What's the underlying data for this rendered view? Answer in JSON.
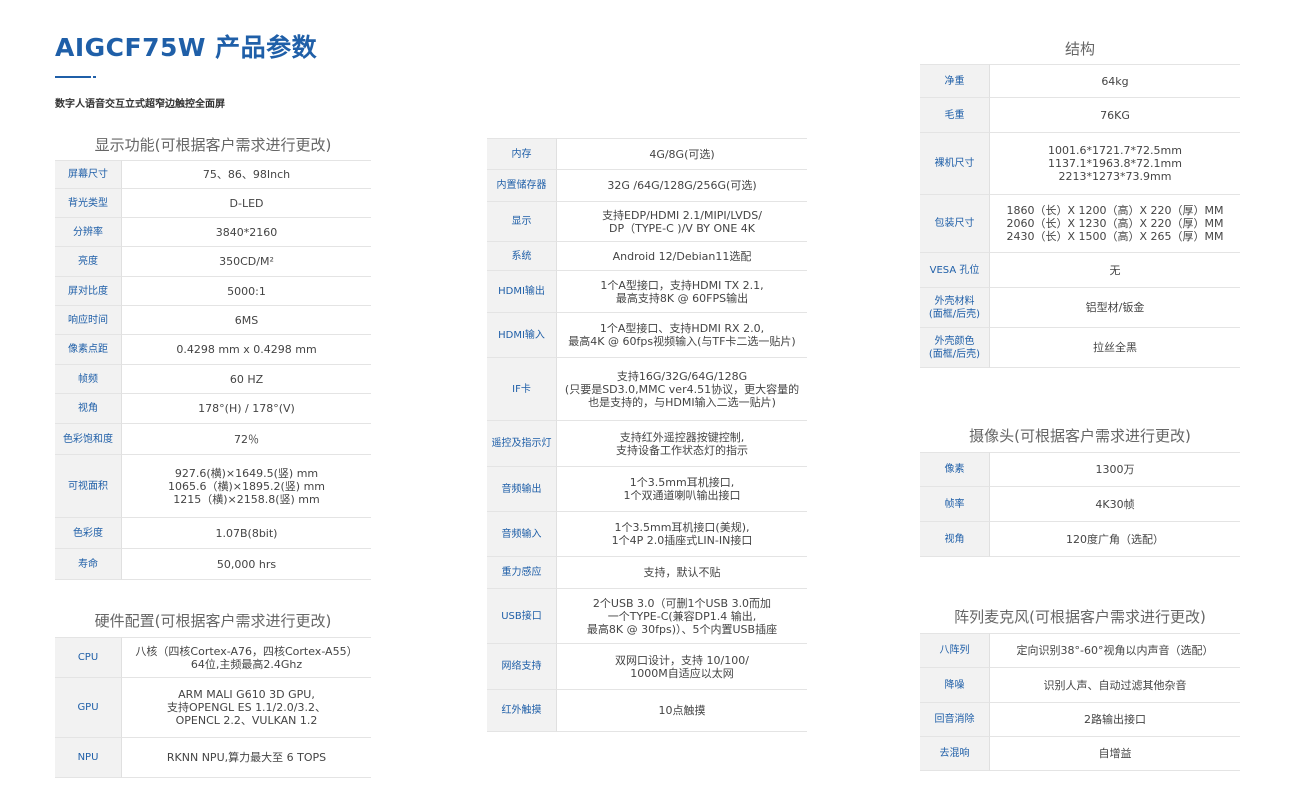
{
  "header": {
    "title": "AIGCF75W 产品参数",
    "subtitle": "数字人语音交互立式超窄边触控全面屏"
  },
  "display": {
    "title": "显示功能(可根据客户需求进行更改)",
    "rows": [
      {
        "k": "屏幕尺寸",
        "v": "75、86、98Inch"
      },
      {
        "k": "背光类型",
        "v": "D-LED"
      },
      {
        "k": "分辨率",
        "v": "3840*2160"
      },
      {
        "k": "亮度",
        "v": "350CD/M²"
      },
      {
        "k": "屏对比度",
        "v": "5000:1"
      },
      {
        "k": "响应时间",
        "v": "6MS"
      },
      {
        "k": "像素点距",
        "v": "0.4298 mm x 0.4298 mm"
      },
      {
        "k": "帧频",
        "v": "60 HZ"
      },
      {
        "k": "视角",
        "v": "178°(H) / 178°(V)"
      },
      {
        "k": "色彩饱和度",
        "v": "72％"
      },
      {
        "k": "可视面积",
        "v": "927.6(横)×1649.5(竖) mm\n1065.6（横)×1895.2(竖) mm\n1215（横)×2158.8(竖) mm"
      },
      {
        "k": "色彩度",
        "v": "1.07B(8bit)"
      },
      {
        "k": "寿命",
        "v": "50,000 hrs"
      }
    ]
  },
  "hardware": {
    "title": "硬件配置(可根据客户需求进行更改)",
    "rows": [
      {
        "k": "CPU",
        "v": "八核（四核Cortex-A76，四核Cortex-A55）\n64位,主频最高2.4Ghz"
      },
      {
        "k": "GPU",
        "v": "ARM MALI G610 3D GPU,\n支持OPENGL ES 1.1/2.0/3.2、\nOPENCL 2.2、VULKAN 1.2"
      },
      {
        "k": "NPU",
        "v": "RKNN NPU,算力最大至 6 TOPS"
      }
    ]
  },
  "middle": {
    "rows": [
      {
        "k": "内存",
        "v": "4G/8G(可选)"
      },
      {
        "k": "内置储存器",
        "v": "32G /64G/128G/256G(可选)"
      },
      {
        "k": "显示",
        "v": "支持EDP/HDMI 2.1/MIPI/LVDS/\nDP（TYPE-C )/V BY ONE  4K"
      },
      {
        "k": "系统",
        "v": "Android 12/Debian11选配"
      },
      {
        "k": "HDMI输出",
        "v": "1个A型接口，支持HDMI TX 2.1,\n最高支持8K @ 60FPS输出"
      },
      {
        "k": "HDMI输入",
        "v": "1个A型接口、支持HDMI RX 2.0,\n最高4K @ 60fps视频输入(与TF卡二选一贴片)"
      },
      {
        "k": "IF卡",
        "v": "支持16G/32G/64G/128G\n(只要是SD3.0,MMC ver4.51协议，更大容量的\n也是支持的，与HDMI输入二选一贴片)"
      },
      {
        "k": "遥控及指示灯",
        "v": "支持红外遥控器按键控制,\n支持设备工作状态灯的指示"
      },
      {
        "k": "音频输出",
        "v": "1个3.5mm耳机接口,\n1个双通道喇叭输出接口"
      },
      {
        "k": "音频输入",
        "v": "1个3.5mm耳机接口(美规),\n1个4P 2.0插座式LIN-IN接口"
      },
      {
        "k": "重力感应",
        "v": "支持，默认不贴"
      },
      {
        "k": "USB接口",
        "v": "2个USB 3.0（可删1个USB 3.0而加\n一个TYPE-C(兼容DP1.4 输出,\n最高8K @ 30fps)）、5个内置USB插座"
      },
      {
        "k": "网络支持",
        "v": "双网口设计，支持 10/100/\n1000M自适应以太网"
      },
      {
        "k": "红外触摸",
        "v": "10点触摸"
      }
    ]
  },
  "structure": {
    "title": "结构",
    "rows": [
      {
        "k": "净重",
        "v": "64kg"
      },
      {
        "k": "毛重",
        "v": "76KG"
      },
      {
        "k": "裸机尺寸",
        "v": "1001.6*1721.7*72.5mm\n1137.1*1963.8*72.1mm\n2213*1273*73.9mm"
      },
      {
        "k": "包装尺寸",
        "v": "1860（长）X 1200（高）X 220（厚）MM\n2060（长）X 1230（高）X 220（厚）MM\n2430（长）X 1500（高）X 265（厚）MM"
      },
      {
        "k": "VESA 孔位",
        "v": "无"
      },
      {
        "k": "外壳材料\n(面框/后壳)",
        "v": "铝型材/钣金"
      },
      {
        "k": "外壳颜色\n(面框/后壳)",
        "v": "拉丝全黑"
      }
    ]
  },
  "camera": {
    "title": "摄像头(可根据客户需求进行更改)",
    "rows": [
      {
        "k": "像素",
        "v": "1300万"
      },
      {
        "k": "帧率",
        "v": "4K30帧"
      },
      {
        "k": "视角",
        "v": "120度广角（选配）"
      }
    ]
  },
  "mic": {
    "title": "阵列麦克风(可根据客户需求进行更改)",
    "rows": [
      {
        "k": "八阵列",
        "v": "定向识别38°-60°视角以内声音（选配）"
      },
      {
        "k": "降噪",
        "v": "识别人声、自动过滤其他杂音"
      },
      {
        "k": "回音消除",
        "v": "2路输出接口"
      },
      {
        "k": "去混响",
        "v": "自增益"
      }
    ]
  }
}
